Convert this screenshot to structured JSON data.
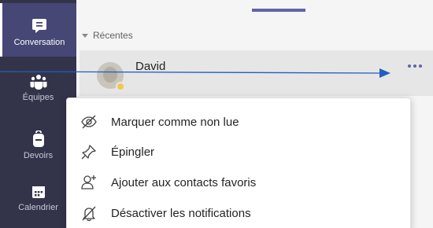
{
  "sidebar": {
    "items": [
      {
        "label": "Conversation",
        "icon": "chat-icon",
        "active": true
      },
      {
        "label": "Équipes",
        "icon": "teams-icon",
        "active": false
      },
      {
        "label": "Devoirs",
        "icon": "backpack-icon",
        "active": false
      },
      {
        "label": "Calendrier",
        "icon": "calendar-icon",
        "active": false
      }
    ]
  },
  "chat_list": {
    "section_title": "Récentes",
    "selected_chat": {
      "name": "David",
      "status_color": "#f2c94c"
    }
  },
  "context_menu": {
    "items": [
      {
        "label": "Marquer comme non lue",
        "icon": "eye-off-icon"
      },
      {
        "label": "Épingler",
        "icon": "pin-icon"
      },
      {
        "label": "Ajouter aux contacts favoris",
        "icon": "add-contact-icon"
      },
      {
        "label": "Désactiver les notifications",
        "icon": "bell-off-icon"
      }
    ]
  },
  "colors": {
    "sidebar_bg": "#33344a",
    "sidebar_active": "#464775",
    "accent": "#6264a7",
    "annotation_line": "#1f5fbf"
  }
}
